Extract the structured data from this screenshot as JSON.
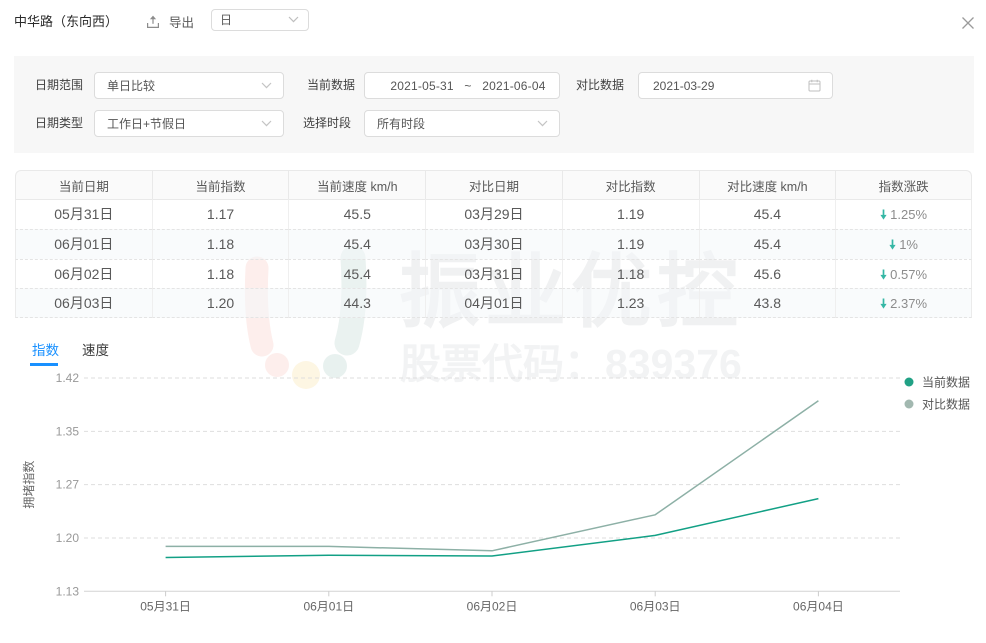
{
  "header": {
    "title": "中华路（东向西）",
    "export_label": "导出",
    "period_select_value": "日"
  },
  "filters": {
    "date_range_label": "日期范围",
    "date_range_value": "单日比较",
    "current_data_label": "当前数据",
    "current_data_start": "2021-05-31",
    "current_data_separator": "~",
    "current_data_end": "2021-06-04",
    "compare_data_label": "对比数据",
    "compare_data_value": "2021-03-29",
    "date_type_label": "日期类型",
    "date_type_value": "工作日+节假日",
    "time_period_label": "选择时段",
    "time_period_value": "所有时段"
  },
  "table": {
    "columns": [
      "当前日期",
      "当前指数",
      "当前速度 km/h",
      "对比日期",
      "对比指数",
      "对比速度 km/h",
      "指数涨跌"
    ],
    "rows": [
      [
        "05月31日",
        "1.17",
        "45.5",
        "03月29日",
        "1.19",
        "45.4",
        "1.25%"
      ],
      [
        "06月01日",
        "1.18",
        "45.4",
        "03月30日",
        "1.19",
        "45.4",
        "1%"
      ],
      [
        "06月02日",
        "1.18",
        "45.4",
        "03月31日",
        "1.18",
        "45.6",
        "0.57%"
      ],
      [
        "06月03日",
        "1.20",
        "44.3",
        "04月01日",
        "1.23",
        "43.8",
        "2.37%"
      ]
    ],
    "change_direction": "down",
    "arrow_color": "#35b7a5"
  },
  "watermark": {
    "line1": "振业优控",
    "line2": "股票代码：839376"
  },
  "tabs": [
    {
      "label": "指数",
      "active": true
    },
    {
      "label": "速度",
      "active": false
    }
  ],
  "chart_data": {
    "type": "line",
    "x": [
      "05月31日",
      "06月01日",
      "06月02日",
      "06月03日",
      "06月04日"
    ],
    "series": [
      {
        "name": "当前数据",
        "color": "#12a085",
        "dot_color": "#21a185",
        "values": [
          1.176,
          1.179,
          1.178,
          1.206,
          1.256
        ]
      },
      {
        "name": "对比数据",
        "color": "#8db0a6",
        "dot_color": "#a2b8b0",
        "values": [
          1.191,
          1.191,
          1.185,
          1.234,
          1.389
        ]
      }
    ],
    "ylabel": "拥堵指数",
    "ylim": [
      1.13,
      1.42
    ],
    "yticks": [
      1.13,
      1.2,
      1.27,
      1.35,
      1.42
    ],
    "ytick_labels": [
      "1.13",
      "1.20",
      "1.27",
      "1.35",
      "1.42"
    ],
    "grid": "dashed",
    "legend_position": "top-right"
  }
}
